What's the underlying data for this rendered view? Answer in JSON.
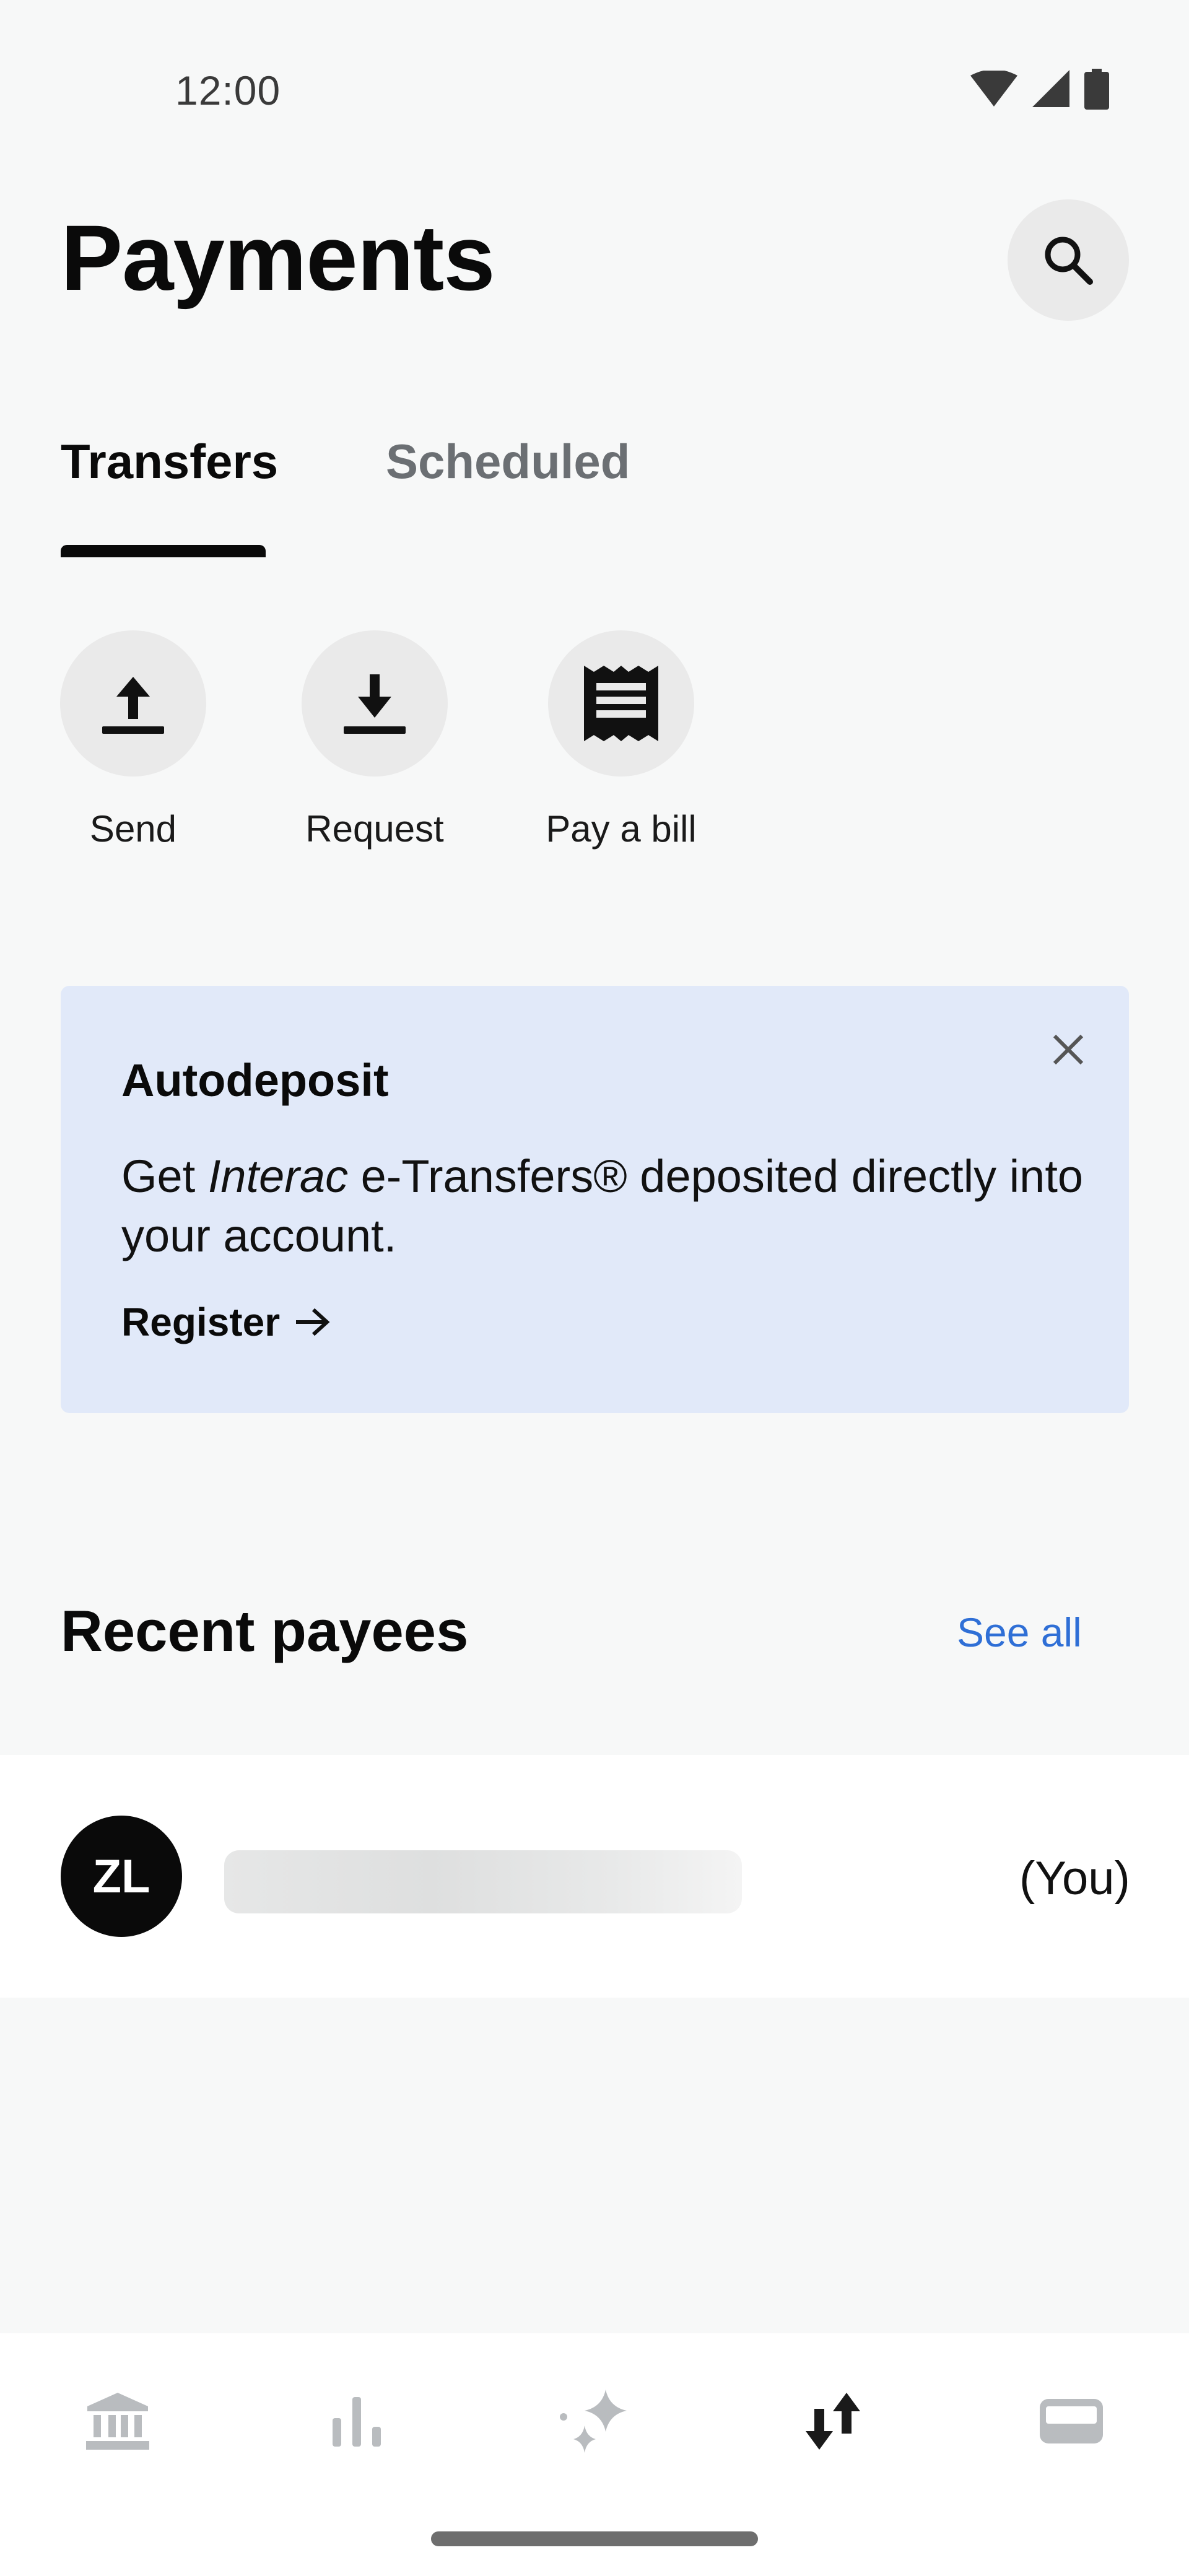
{
  "status_bar": {
    "time": "12:00",
    "icons": [
      "wifi-icon",
      "cellular-signal-icon",
      "battery-icon"
    ]
  },
  "header": {
    "title": "Payments",
    "search_icon": "search-icon"
  },
  "tabs": [
    {
      "label": "Transfers",
      "selected": true
    },
    {
      "label": "Scheduled",
      "selected": false
    }
  ],
  "quick_actions": [
    {
      "label": "Send",
      "icon": "upload-arrow-icon"
    },
    {
      "label": "Request",
      "icon": "download-arrow-icon"
    },
    {
      "label": "Pay a bill",
      "icon": "receipt-icon"
    }
  ],
  "autodeposit_card": {
    "title": "Autodeposit",
    "body_prefix": "Get ",
    "body_italic": "Interac",
    "body_suffix": " e-Transfers® deposited directly into your account.",
    "link_label": "Register",
    "background_color": "#e1e9f9"
  },
  "recent_payees": {
    "title": "Recent payees",
    "see_all_label": "See all",
    "items": [
      {
        "initials": "ZL",
        "suffix": "(You)"
      }
    ]
  },
  "bottom_nav": {
    "items": [
      {
        "icon": "bank-icon",
        "active": false
      },
      {
        "icon": "bar-chart-icon",
        "active": false
      },
      {
        "icon": "sparkle-icon",
        "active": false
      },
      {
        "icon": "transfer-arrows-icon",
        "active": true
      },
      {
        "icon": "card-icon",
        "active": false
      }
    ]
  },
  "colors": {
    "background": "#f7f8f8",
    "accent_link": "#2f6fd6",
    "inactive_tab": "#6b6f73",
    "inactive_nav_icon": "#b9bcbf"
  }
}
